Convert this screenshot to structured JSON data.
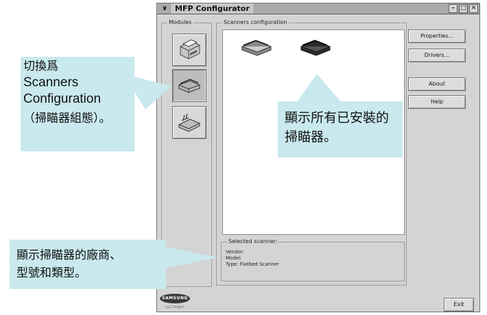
{
  "window": {
    "menu_glyph": "∨",
    "title": "MFP Configurator",
    "controls": [
      "–",
      "□",
      "✕"
    ]
  },
  "modules": {
    "legend": "Modules",
    "items": [
      {
        "name": "printer-module",
        "icon": "printer-icon"
      },
      {
        "name": "scanner-module",
        "icon": "scanner-icon",
        "active": true
      },
      {
        "name": "port-module",
        "icon": "port-icon"
      }
    ]
  },
  "scanners": {
    "legend": "Scanners configuration",
    "items": [
      {
        "name": "scanner-light",
        "icon": "flatbed-scanner-icon",
        "color": "#8a8a8a"
      },
      {
        "name": "scanner-dark",
        "icon": "flatbed-scanner-icon",
        "color": "#2e2e2e"
      }
    ]
  },
  "selected": {
    "legend": "Selected scanner:",
    "vendor": "Vendor:",
    "model": "Model:",
    "type": "Type: Flatbed Scanner"
  },
  "buttons": {
    "properties": "Properties...",
    "drivers": "Drivers...",
    "about": "About",
    "help": "Help",
    "exit": "Exit"
  },
  "brand": {
    "logo": "SAMSUNG",
    "sub": "ELECTRONICS"
  },
  "callouts": {
    "switch": {
      "line1": "切換爲",
      "line2": "Scanners",
      "line3": "Configuration",
      "line4": "（掃瞄器組態）。"
    },
    "installed": {
      "line1": "顯示所有已安裝的",
      "line2": "掃瞄器。"
    },
    "vendor_info": {
      "line1": "顯示掃瞄器的廠商、",
      "line2": "型號和類型。"
    }
  },
  "colors": {
    "callout_bg": "#c9e9ee",
    "window_bg": "#d4d4d4"
  }
}
